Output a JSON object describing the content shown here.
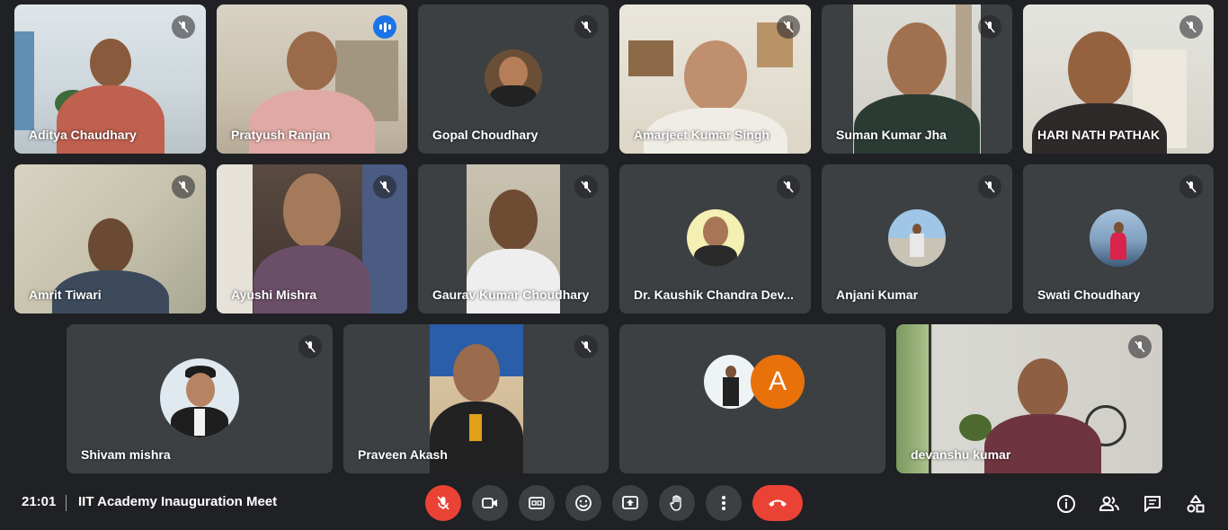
{
  "participants": [
    {
      "name": "Aditya Chaudhary"
    },
    {
      "name": "Pratyush Ranjan"
    },
    {
      "name": "Gopal Choudhary"
    },
    {
      "name": "Amarjeet Kumar Singh"
    },
    {
      "name": "Suman Kumar Jha"
    },
    {
      "name": "HARI NATH PATHAK"
    },
    {
      "name": "Amrit Tiwari"
    },
    {
      "name": "Ayushi Mishra"
    },
    {
      "name": "Gaurav Kumar Choudhary"
    },
    {
      "name": "Dr. Kaushik Chandra Dev..."
    },
    {
      "name": "Anjani Kumar"
    },
    {
      "name": "Swati Choudhary"
    },
    {
      "name": "Shivam mishra"
    },
    {
      "name": "Praveen Akash"
    },
    {
      "name": ""
    },
    {
      "name": "devanshu kumar"
    }
  ],
  "extra_tile_letter": "A",
  "meeting": {
    "time": "21:01",
    "title": "IIT Academy Inauguration Meet"
  },
  "colors": {
    "background": "#202124",
    "tile": "#3c4043",
    "accent_blue": "#8ab4f8",
    "red": "#ea4335",
    "orange_avatar": "#e8710a"
  }
}
